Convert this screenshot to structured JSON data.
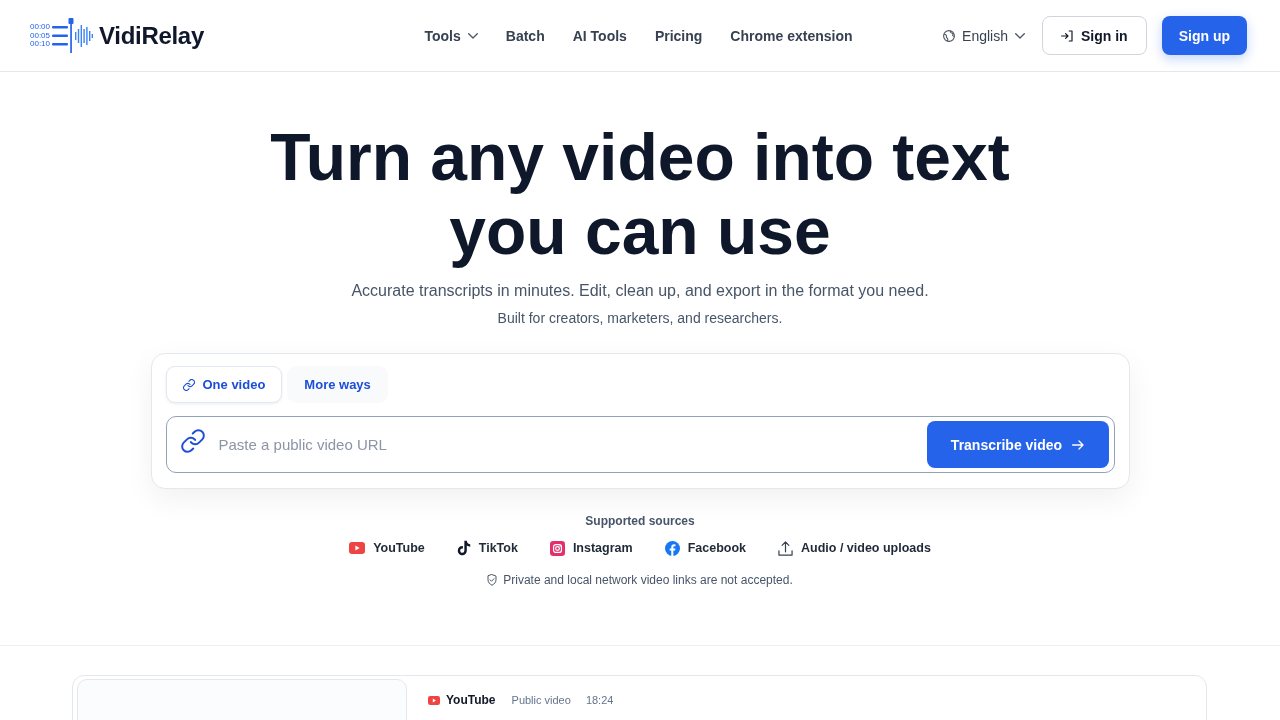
{
  "header": {
    "logo": {
      "timestamps": [
        "00:00",
        "00:05",
        "00:10"
      ],
      "name": "VidiRelay"
    },
    "nav": [
      {
        "label": "Tools",
        "dropdown": true
      },
      {
        "label": "Batch",
        "dropdown": false
      },
      {
        "label": "AI Tools",
        "dropdown": false
      },
      {
        "label": "Pricing",
        "dropdown": false
      },
      {
        "label": "Chrome extension",
        "dropdown": false
      }
    ],
    "language": "English",
    "sign_in": "Sign in",
    "sign_up": "Sign up"
  },
  "hero": {
    "title": "Turn any video into text you can use",
    "subtitle": "Accurate transcripts in minutes. Edit, clean up, and export in the format you need.",
    "tagline": "Built for creators, marketers, and researchers."
  },
  "transcribe_card": {
    "tabs": [
      {
        "label": "One video",
        "kind": "link",
        "selected": true
      },
      {
        "label": "More ways",
        "kind": "text",
        "selected": false
      }
    ],
    "url_field": {
      "placeholder": "Paste a public video URL"
    },
    "submit": "Transcribe video"
  },
  "sources": {
    "heading": "Supported sources",
    "items": [
      {
        "label": "YouTube",
        "kind": "youtube"
      },
      {
        "label": "TikTok",
        "kind": "tiktok"
      },
      {
        "label": "Instagram",
        "kind": "instagram"
      },
      {
        "label": "Facebook",
        "kind": "facebook"
      },
      {
        "label": "Audio / video uploads",
        "kind": "upload"
      }
    ],
    "note": "Private and local network video links are not accepted."
  },
  "example": {
    "platform": {
      "label": "YouTube",
      "kind": "youtube"
    },
    "visibility": "Public video",
    "duration": "18:24"
  }
}
